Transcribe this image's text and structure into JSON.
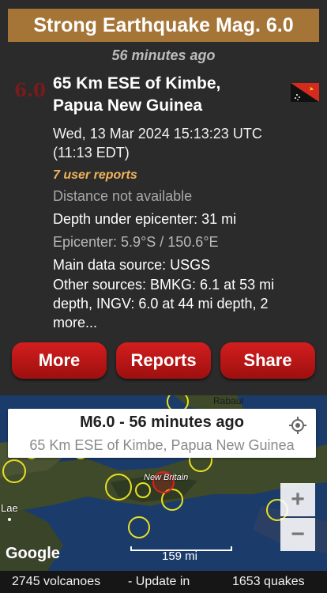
{
  "header": {
    "title": "Strong Earthquake Mag. 6.0",
    "time_ago": "56 minutes ago"
  },
  "quake": {
    "magnitude": "6.0",
    "place_line1": "65 Km ESE of Kimbe,",
    "place_line2": "Papua New Guinea",
    "date_line1": "Wed, 13 Mar 2024 15:13:23 UTC",
    "date_line2": "(11:13 EDT)",
    "user_reports": "7 user reports",
    "distance": "Distance not available",
    "depth": "Depth under epicenter: 31 mi",
    "epicenter": "Epicenter: 5.9°S / 150.6°E",
    "main_source": "Main data source: USGS",
    "other_sources_l1": "Other sources: BMKG: 6.1 at 53 mi",
    "other_sources_l2": "depth, INGV: 6.0 at 44 mi depth, 2",
    "other_sources_l3": "more..."
  },
  "buttons": {
    "more": "More",
    "reports": "Reports",
    "share": "Share"
  },
  "map": {
    "popup_title": "M6.0  -  56 minutes ago",
    "popup_subtitle": "65 Km ESE of Kimbe, Papua New Guinea",
    "label_rabaul": "Rabaul",
    "label_new_britain": "New Britain",
    "label_lae": "Lae",
    "attribution": "Google",
    "scale": "159 mi",
    "zoom_in": "+",
    "zoom_out": "−"
  },
  "footer": {
    "volcanoes": "2745 volcanoes",
    "update": "- Update in",
    "quakes": "1653 quakes"
  },
  "colors": {
    "banner": "#a57437",
    "button_red": "#c41a1a",
    "reports_text": "#f0b35a",
    "magnitude": "#7a1a1a",
    "quake_circle": "#e8e022",
    "main_quake_circle": "#e02020"
  }
}
